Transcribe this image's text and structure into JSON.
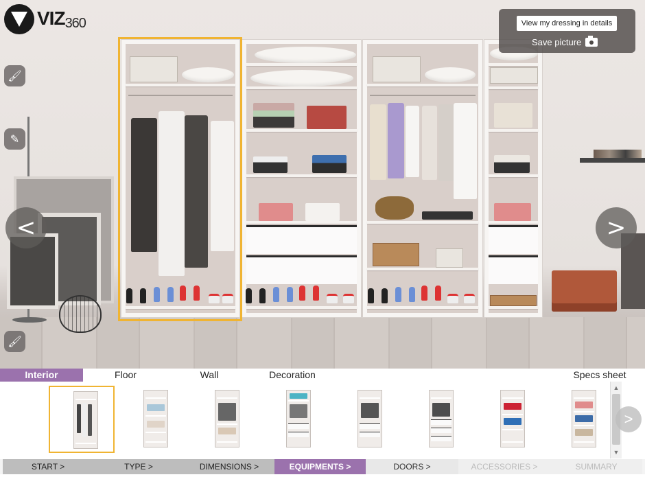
{
  "brand": {
    "logo_text": "VIZ",
    "logo_number": "360"
  },
  "panel": {
    "details_button": "View my dressing in details",
    "save_picture": "Save picture"
  },
  "icons": {
    "tool_top": "paint-roller-icon",
    "tool_middle": "pencil-icon",
    "tool_bottom": "paint-roller-icon",
    "camera": "camera-icon"
  },
  "arrows": {
    "prev": "<",
    "next": ">",
    "thumb_next": ">"
  },
  "tabs": [
    {
      "label": "Interior",
      "active": true
    },
    {
      "label": "Floor",
      "active": false
    },
    {
      "label": "Wall",
      "active": false
    },
    {
      "label": "Decoration",
      "active": false
    },
    {
      "label": "Specs sheet",
      "active": false
    }
  ],
  "thumbnails": {
    "count": 8,
    "selected_index": 0
  },
  "steps": [
    {
      "label": "START >",
      "state": "done"
    },
    {
      "label": "TYPE >",
      "state": "done"
    },
    {
      "label": "DIMENSIONS >",
      "state": "done"
    },
    {
      "label": "EQUIPMENTS >",
      "state": "active"
    },
    {
      "label": "DOORS >",
      "state": "next"
    },
    {
      "label": "ACCESSORIES >",
      "state": "future"
    },
    {
      "label": "SUMMARY",
      "state": "future"
    }
  ],
  "colors": {
    "accent": "#9b72ad",
    "selection": "#f0b432",
    "panel_bg": "#504c4a"
  }
}
